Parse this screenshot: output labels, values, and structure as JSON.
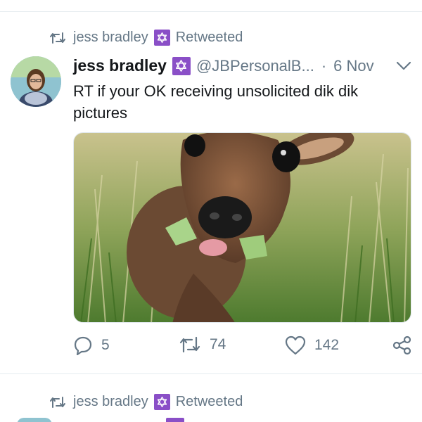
{
  "retweet_header": {
    "user": "jess bradley",
    "action": "Retweeted"
  },
  "tweet": {
    "name": "jess bradley",
    "handle": "@JBPersonalB...",
    "separator": "·",
    "time": "6 Nov",
    "text": "RT if your OK receiving unsolicited dik dik pictures",
    "media_description": "photo of a dik dik eating leaves in grass"
  },
  "actions": {
    "replies": "5",
    "retweets": "74",
    "likes": "142"
  },
  "next_retweet_header": {
    "user": "jess bradley",
    "action": "Retweeted"
  },
  "colors": {
    "badge": "#8a4fc7",
    "muted": "#657786",
    "divider": "#e6ecf0"
  }
}
